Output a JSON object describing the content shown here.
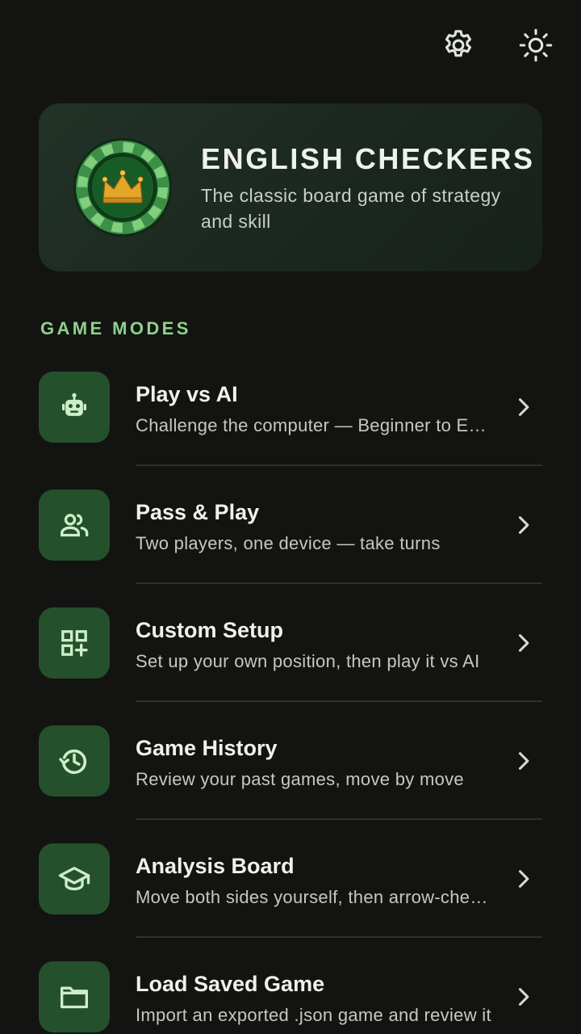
{
  "top_bar": {
    "settings_icon": "gear-icon",
    "theme_icon": "sun-icon"
  },
  "hero": {
    "title": "ENGLISH CHECKERS",
    "subtitle": "The classic board game of strategy and skill",
    "badge_icon": "crown-icon"
  },
  "section": {
    "label": "GAME MODES"
  },
  "modes": [
    {
      "icon": "robot-icon",
      "title": "Play vs AI",
      "description": "Challenge the computer — Beginner to Expert"
    },
    {
      "icon": "people-icon",
      "title": "Pass & Play",
      "description": "Two players, one device — take turns"
    },
    {
      "icon": "grid-add-icon",
      "title": "Custom Setup",
      "description": "Set up your own position, then play it vs AI"
    },
    {
      "icon": "history-icon",
      "title": "Game History",
      "description": "Review your past games, move by move"
    },
    {
      "icon": "graduation-cap-icon",
      "title": "Analysis Board",
      "description": "Move both sides yourself, then arrow-check the position"
    },
    {
      "icon": "folder-icon",
      "title": "Load Saved Game",
      "description": "Import an exported .json game and review it"
    }
  ],
  "colors": {
    "background": "#131412",
    "accent": "#8fd18a",
    "icon_tile": "#24512b",
    "icon_fg": "#cfeec8"
  }
}
